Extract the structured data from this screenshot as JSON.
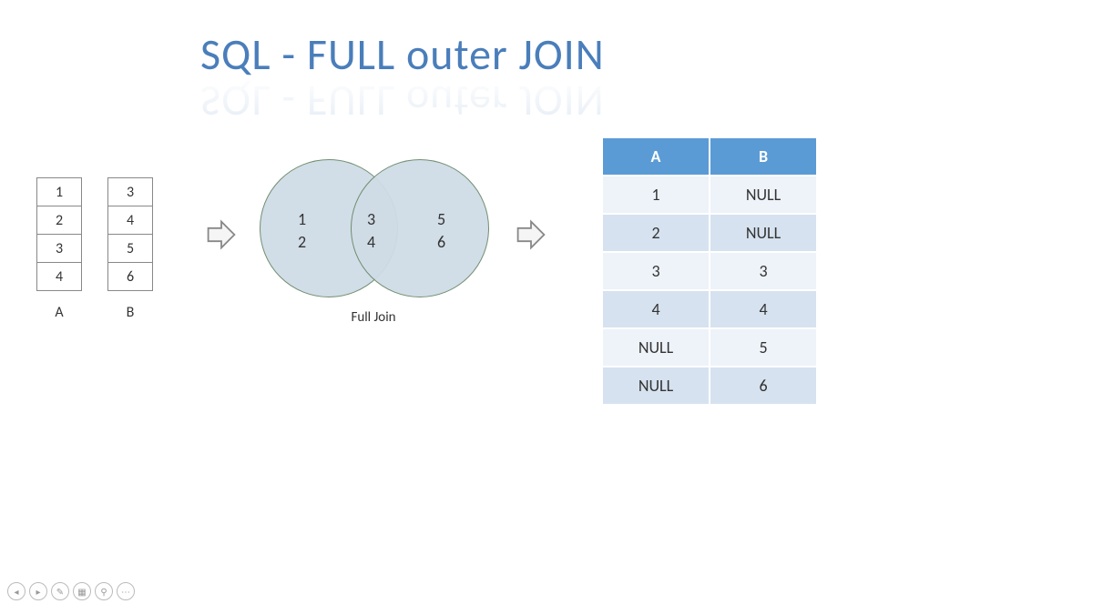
{
  "title": "SQL - FULL outer JOIN",
  "source": {
    "tableA": {
      "label": "A",
      "values": [
        "1",
        "2",
        "3",
        "4"
      ]
    },
    "tableB": {
      "label": "B",
      "values": [
        "3",
        "4",
        "5",
        "6"
      ]
    }
  },
  "venn": {
    "label": "Full Join",
    "left_only": [
      "1",
      "2"
    ],
    "intersection": [
      "3",
      "4"
    ],
    "right_only": [
      "5",
      "6"
    ]
  },
  "result": {
    "headers": {
      "A": "A",
      "B": "B"
    },
    "rows": [
      {
        "A": "1",
        "B": "NULL"
      },
      {
        "A": "2",
        "B": "NULL"
      },
      {
        "A": "3",
        "B": "3"
      },
      {
        "A": "4",
        "B": "4"
      },
      {
        "A": "NULL",
        "B": "5"
      },
      {
        "A": "NULL",
        "B": "6"
      }
    ]
  },
  "toolbar": {
    "prev": "◂",
    "next": "▸",
    "pen": "✎",
    "grid": "▦",
    "zoom": "⚲",
    "more": "⋯"
  }
}
